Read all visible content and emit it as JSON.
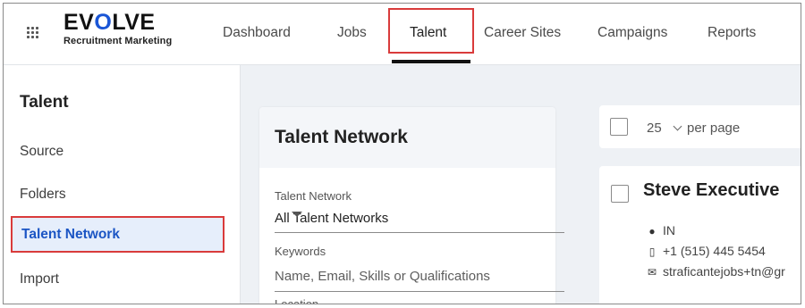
{
  "brand": {
    "name_prefix": "EV",
    "name_o": "O",
    "name_suffix": "LVE",
    "tagline": "Recruitment Marketing"
  },
  "nav": {
    "items": [
      {
        "label": "Dashboard"
      },
      {
        "label": "Jobs"
      },
      {
        "label": "Talent",
        "active": true
      },
      {
        "label": "Career Sites"
      },
      {
        "label": "Campaigns"
      },
      {
        "label": "Reports"
      }
    ]
  },
  "sidebar": {
    "title": "Talent",
    "items": [
      {
        "label": "Source"
      },
      {
        "label": "Folders"
      },
      {
        "label": "Talent Network",
        "active": true
      },
      {
        "label": "Import"
      }
    ]
  },
  "filter": {
    "title": "Talent Network",
    "network_label": "Talent Network",
    "network_value": "All Talent Networks",
    "keywords_label": "Keywords",
    "keywords_placeholder": "Name, Email, Skills or Qualifications",
    "location_label": "Location"
  },
  "results": {
    "per_page_value": "25",
    "per_page_label": "per page",
    "candidate": {
      "name": "Steve Executive",
      "location": "IN",
      "phone": "+1 (515) 445 5454",
      "email": "straficantejobs+tn@gr"
    }
  },
  "colors": {
    "accent": "#1a56d6",
    "highlight_border": "#d93b3b",
    "active_sidebar_bg": "#e6eefb"
  }
}
